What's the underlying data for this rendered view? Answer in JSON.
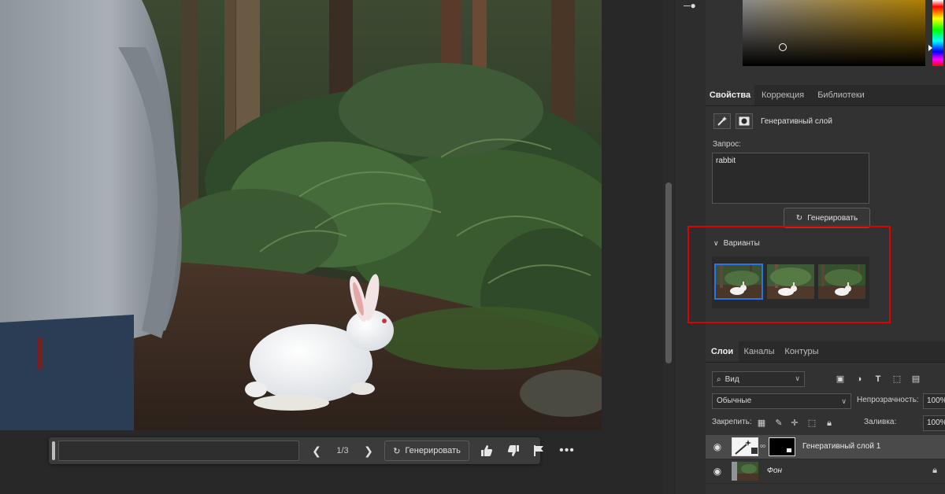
{
  "canvas": {
    "taskbar": {
      "prompt_value": "",
      "variant_counter": "1/3",
      "generate_label": "Генерировать",
      "icons": [
        "chevron-left-icon",
        "chevron-right-icon",
        "refresh-icon",
        "thumbs-up-icon",
        "thumbs-down-icon",
        "flag-icon",
        "more-icon"
      ]
    }
  },
  "colors": {
    "accent": "#2d73e6",
    "highlight": "#e00000",
    "panel_bg": "#323232"
  },
  "properties": {
    "tabs": [
      {
        "label": "Свойства",
        "active": true
      },
      {
        "label": "Коррекция",
        "active": false
      },
      {
        "label": "Библиотеки",
        "active": false
      }
    ],
    "layer_type": "Генеративный слой",
    "prompt_label": "Запрос:",
    "prompt_value": "rabbit",
    "generate_label": "Генерировать",
    "variants_label": "Варианты",
    "variants_count": 3,
    "selected_variant": 1
  },
  "layers": {
    "tabs": [
      {
        "label": "Слои",
        "active": true
      },
      {
        "label": "Каналы",
        "active": false
      },
      {
        "label": "Контуры",
        "active": false
      }
    ],
    "filter_value": "Вид",
    "blend_mode": "Обычные",
    "opacity_label": "Непрозрачность:",
    "opacity_value": "100%",
    "lock_label": "Закрепить:",
    "fill_label": "Заливка:",
    "fill_value": "100%",
    "items": [
      {
        "name": "Генеративный слой 1",
        "visible": true,
        "selected": true
      },
      {
        "name": "Фон",
        "visible": true,
        "locked": true
      }
    ]
  }
}
